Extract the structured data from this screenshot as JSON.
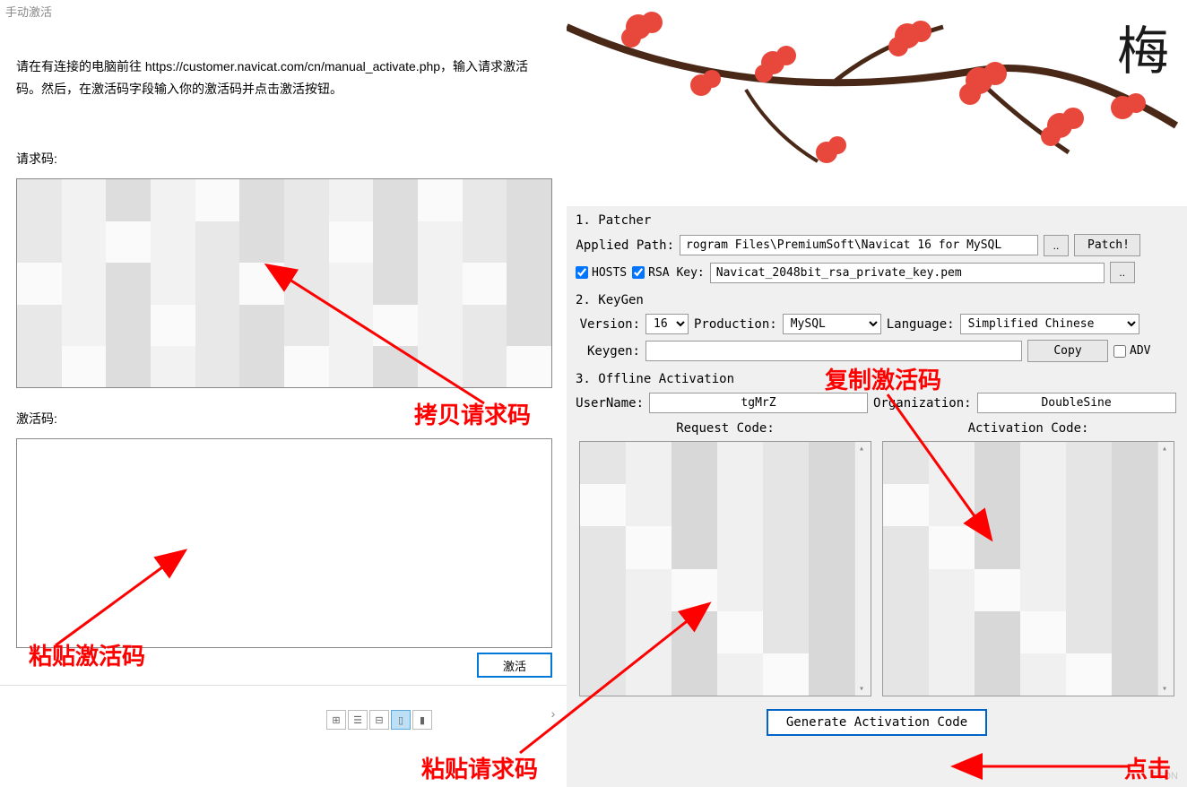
{
  "left": {
    "title": "手动激活",
    "instruction": "请在有连接的电脑前往 https://customer.navicat.com/cn/manual_activate.php，输入请求激活码。然后，在激活码字段输入你的激活码并点击激活按钮。",
    "requestLabel": "请求码:",
    "activationLabel": "激活码:",
    "activateButton": "激活"
  },
  "patcher": {
    "sectionTitle": "1. Patcher",
    "appliedPathLabel": "Applied Path:",
    "appliedPath": "rogram Files\\PremiumSoft\\Navicat 16 for MySQL",
    "browseBtn": "..",
    "patchBtn": "Patch!",
    "hostsLabel": "HOSTS",
    "rsaKeyLabel": "RSA Key:",
    "rsaKeyPath": "Navicat_2048bit_rsa_private_key.pem"
  },
  "keygen": {
    "sectionTitle": "2. KeyGen",
    "versionLabel": "Version:",
    "version": "16",
    "productionLabel": "Production:",
    "production": "MySQL",
    "languageLabel": "Language:",
    "language": "Simplified Chinese",
    "keygenLabel": "Keygen:",
    "keygenValue": "",
    "copyBtn": "Copy",
    "advLabel": "ADV"
  },
  "offline": {
    "sectionTitle": "3. Offline Activation",
    "usernameLabel": "UserName:",
    "username": "tgMrZ",
    "orgLabel": "Organization:",
    "organization": "DoubleSine",
    "requestCodeLabel": "Request Code:",
    "activationCodeLabel": "Activation Code:",
    "generateBtn": "Generate Activation Code"
  },
  "annotations": {
    "copyRequest": "拷贝请求码",
    "pasteActivation": "粘贴激活码",
    "copyActivation": "复制激活码",
    "pasteRequest": "粘贴请求码",
    "click": "点击"
  },
  "decor": {
    "mei": "梅"
  },
  "watermark": "CSDN"
}
